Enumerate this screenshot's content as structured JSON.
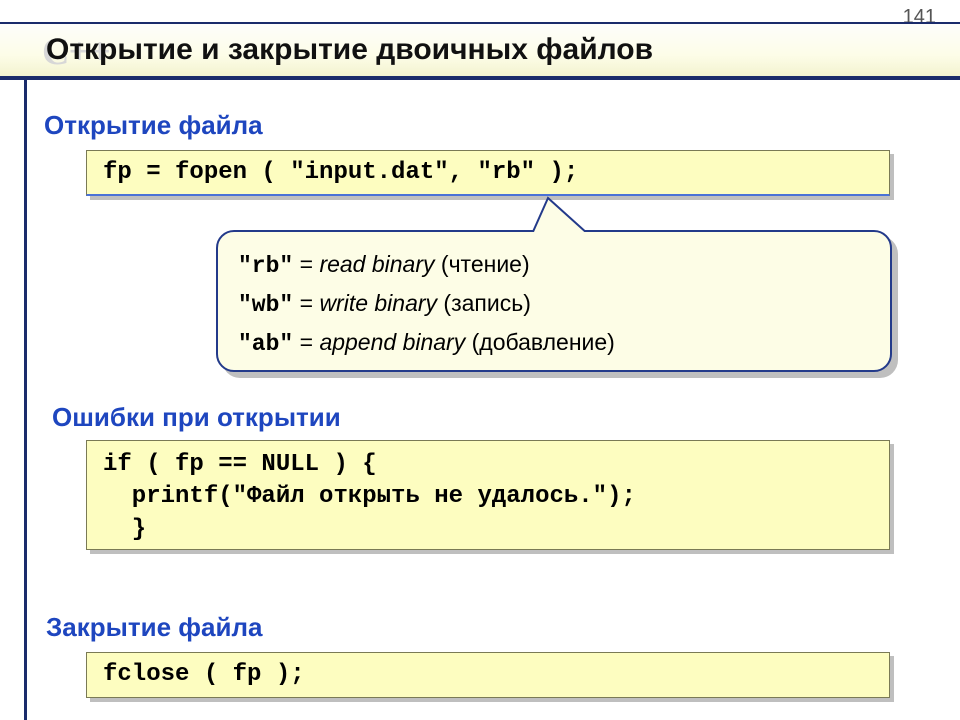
{
  "page_number": "141",
  "logo_text": "C++",
  "title": "Открытие и закрытие двоичных файлов",
  "sections": {
    "open": "Открытие файла",
    "errors": "Ошибки при открытии",
    "close": "Закрытие файла"
  },
  "code": {
    "open": "fp = fopen ( \"input.dat\", \"rb\" );",
    "error": "if ( fp == NULL ) {\n  printf(\"Файл открыть не удалось.\");\n  }",
    "close": "fclose ( fp );"
  },
  "modes": [
    {
      "code": "\"rb\"",
      "eq": " = ",
      "desc": "read binary",
      "note": " (чтение)"
    },
    {
      "code": "\"wb\"",
      "eq": " = ",
      "desc": "write binary",
      "note": " (запись)"
    },
    {
      "code": "\"ab\"",
      "eq": " = ",
      "desc": "append binary",
      "note": " (добавление)"
    }
  ]
}
